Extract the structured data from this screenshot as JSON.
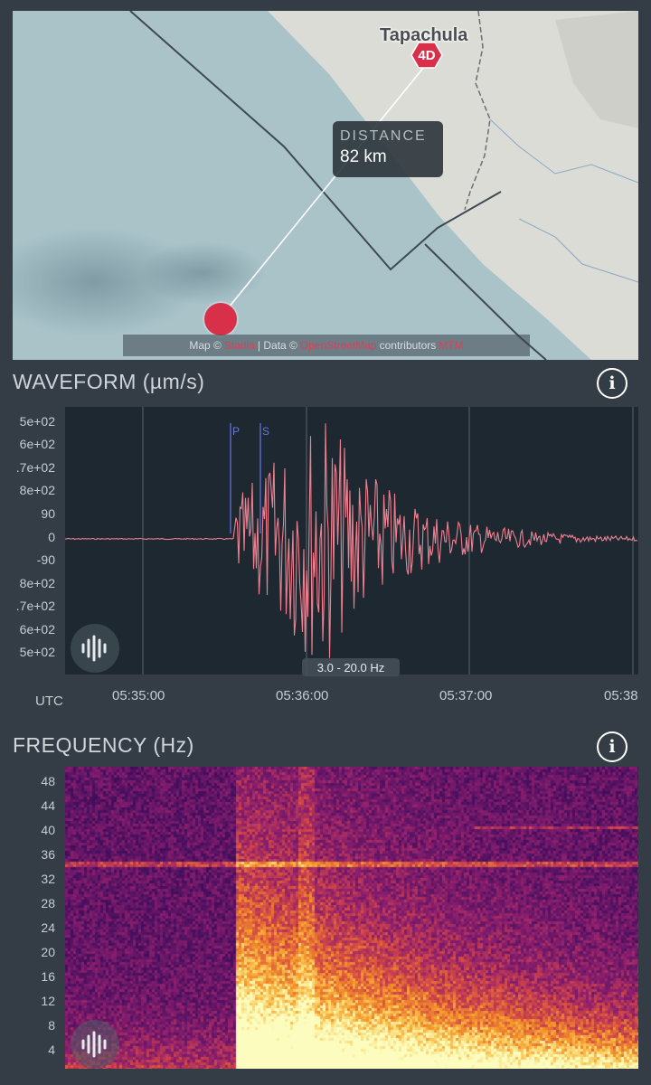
{
  "map": {
    "place_name": "Tapachula",
    "station_code": "4D",
    "distance_label": "DISTANCE",
    "distance_value": "82 km",
    "attribution": {
      "map_prefix": "Map ©",
      "map_link": "Stadia",
      "data_prefix": "| Data ©",
      "data_link": "OpenStreetMap",
      "contributors": "contributors",
      "extra_link": "MTM"
    },
    "colors": {
      "sea": "#a9c3c9",
      "land": "#dcdcd7",
      "marker": "#d9304a"
    }
  },
  "waveform": {
    "title": "WAVEFORM (µm/s)",
    "info_icon": "info-icon",
    "y_ticks": [
      "5e+02",
      "6e+02",
      ".7e+02",
      "8e+02",
      "90",
      "0",
      "-90",
      "8e+02",
      ".7e+02",
      "6e+02",
      "5e+02"
    ],
    "time_zone_label": "UTC",
    "time_labels": [
      "05:35:00",
      "05:36:00",
      "05:37:00",
      "05:38"
    ],
    "phase_labels": [
      "P",
      "S"
    ],
    "filter_label": "3.0 - 20.0 Hz",
    "audio_icon": "waveform-audio-icon",
    "trace_color": "#f08090"
  },
  "frequency": {
    "title": "FREQUENCY (Hz)",
    "info_icon": "info-icon",
    "y_ticks": [
      "48",
      "44",
      "40",
      "36",
      "32",
      "28",
      "24",
      "20",
      "16",
      "12",
      "8",
      "4"
    ],
    "audio_icon": "spectrogram-audio-icon"
  }
}
